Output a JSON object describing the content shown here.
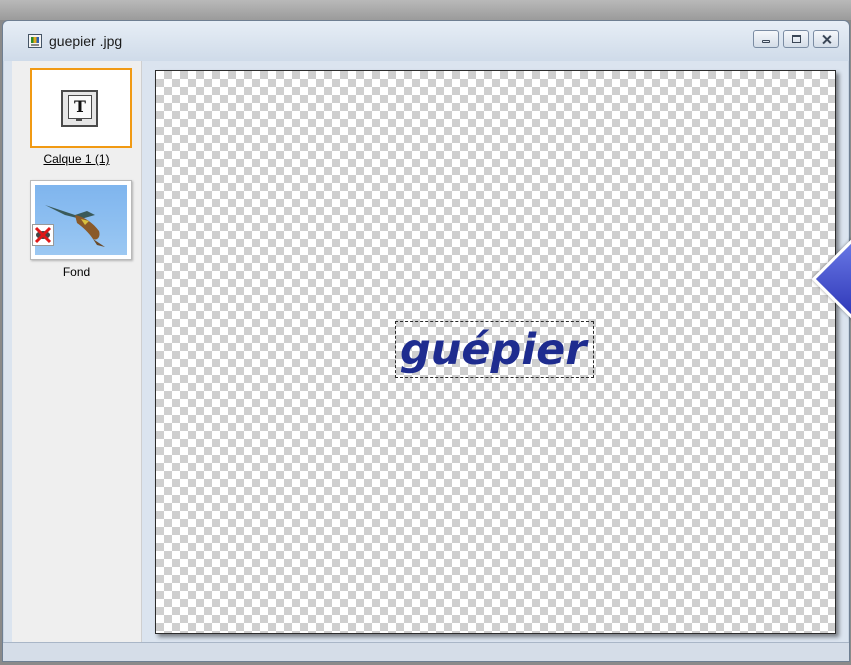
{
  "window": {
    "title": "guepier .jpg",
    "controls": {
      "minimize": "minimize",
      "maximize": "maximize",
      "close": "close"
    }
  },
  "layers": [
    {
      "label": "Calque 1 (1)",
      "type": "text",
      "selected": true,
      "icon": "text-layer-icon"
    },
    {
      "label": "Fond",
      "type": "image",
      "selected": false,
      "visibility_icon": "hidden-eye-icon"
    }
  ],
  "canvas": {
    "text": "guépier",
    "text_color": "#1e2c8f",
    "background": "transparent-checkerboard"
  },
  "colors": {
    "selection_border": "#f19a13",
    "title_bar": "#dbe4ef",
    "arrow_accent": "#3c46c8"
  }
}
